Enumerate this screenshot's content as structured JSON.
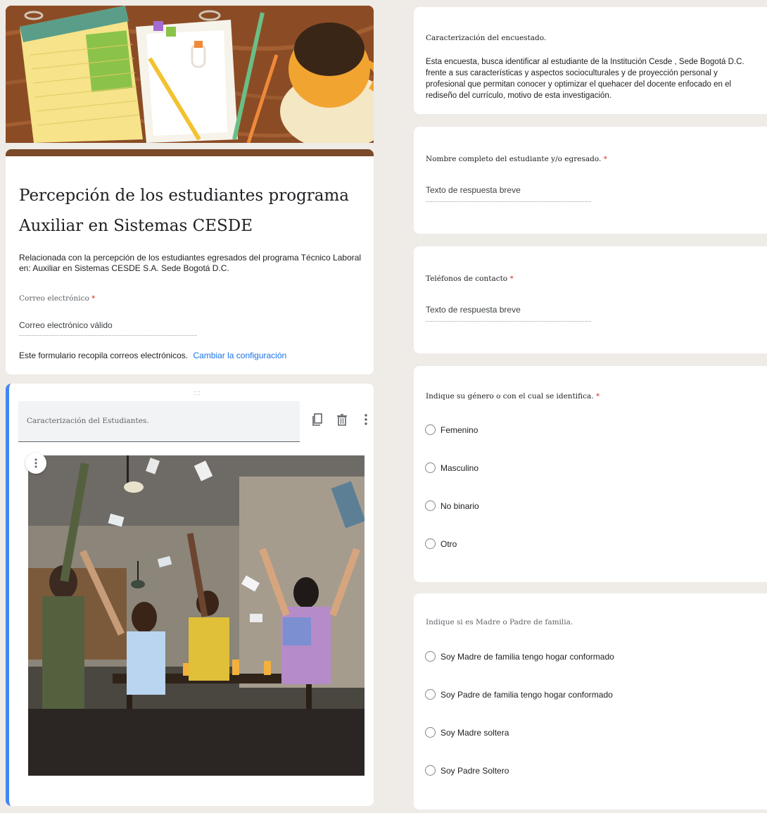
{
  "form": {
    "title": "Percepción de los estudiantes programa Auxiliar en Sistemas CESDE",
    "description": "Relacionada con la percepción de los estudiantes egresados del programa Técnico Laboral en: Auxiliar en Sistemas CESDE S.A. Sede Bogotá D.C.",
    "email_label": "Correo electrónico",
    "required_mark": "*",
    "email_placeholder": "Correo electrónico válido",
    "collect_text": "Este formulario recopila correos electrónicos.",
    "collect_link": "Cambiar la configuración"
  },
  "section": {
    "title_placeholder": "Caracterización del Estudiantes.",
    "drag_handle": ":::"
  },
  "right": {
    "intro_title": "Caracterización del encuestado.",
    "intro_text": "Esta encuesta, busca identificar al estudiante de la Institución Cesde , Sede Bogotá D.C. frente a sus características y aspectos socioculturales y de proyección personal y profesional que permitan conocer y optimizar el quehacer del docente enfocado en el rediseño del currículo, motivo de esta investigación.",
    "q_name": "Nombre completo del estudiante y/o egresado.",
    "q_name_placeholder": "Texto de respuesta breve",
    "q_phone": "Teléfonos de contacto",
    "q_phone_placeholder": "Texto de respuesta breve",
    "q_gender": "Indique su género o con el cual se identifica.",
    "gender_options": [
      "Femenino",
      "Masculino",
      "No binario",
      "Otro"
    ],
    "q_parent": "Indique si es Madre o Padre de familia.",
    "parent_options": [
      "Soy Madre de familia tengo hogar conformado",
      "Soy Padre de familia tengo hogar conformado",
      "Soy Madre soltera",
      "Soy Padre Soltero"
    ]
  },
  "icons": [
    "copy-icon",
    "trash-icon",
    "more-vert-icon",
    "image-menu-icon",
    "drag-handle-icon"
  ],
  "colors": {
    "accent": "#4285f4",
    "header_bar": "#7a4a2a",
    "link": "#1a73e8",
    "required": "#d93025"
  }
}
